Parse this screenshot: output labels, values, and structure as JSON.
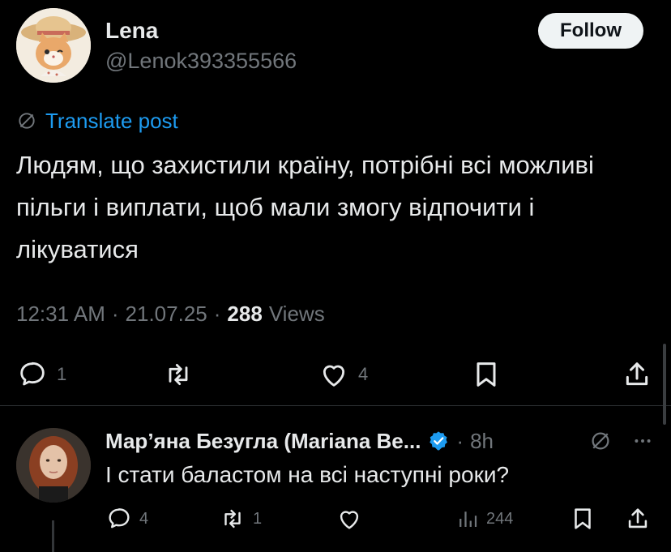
{
  "post": {
    "author_name": "Lena",
    "author_handle": "@Lenok393355566",
    "follow_label": "Follow",
    "translate_label": "Translate post",
    "text": "Людям, що захистили країну, потрібні всі можливі пільги і виплати, щоб мали змогу відпочити і лікуватися",
    "time": "12:31 AM",
    "date": "21.07.25",
    "views_count": "288",
    "views_label": "Views",
    "separator": "·",
    "replies": "1",
    "likes": "4",
    "icons": [
      "comment-icon",
      "retweet-icon",
      "heart-icon",
      "bookmark-icon",
      "share-icon",
      "translate-icon"
    ]
  },
  "reply": {
    "author_name": "Мар’яна Безугла (Mariana Be...",
    "time": "8h",
    "separator": "·",
    "text": "І стати баластом на всі наступні роки?",
    "replies": "4",
    "retweets": "1",
    "views": "244",
    "verified_color": "#1d9bf0",
    "icons": [
      "comment-icon",
      "retweet-icon",
      "heart-icon",
      "views-icon",
      "bookmark-icon",
      "share-icon",
      "more-icon",
      "grok-icon",
      "verified-badge-icon"
    ]
  },
  "colors": {
    "background": "#000000",
    "text": "#e7e9ea",
    "muted": "#71767b",
    "accent": "#1d9bf0"
  }
}
